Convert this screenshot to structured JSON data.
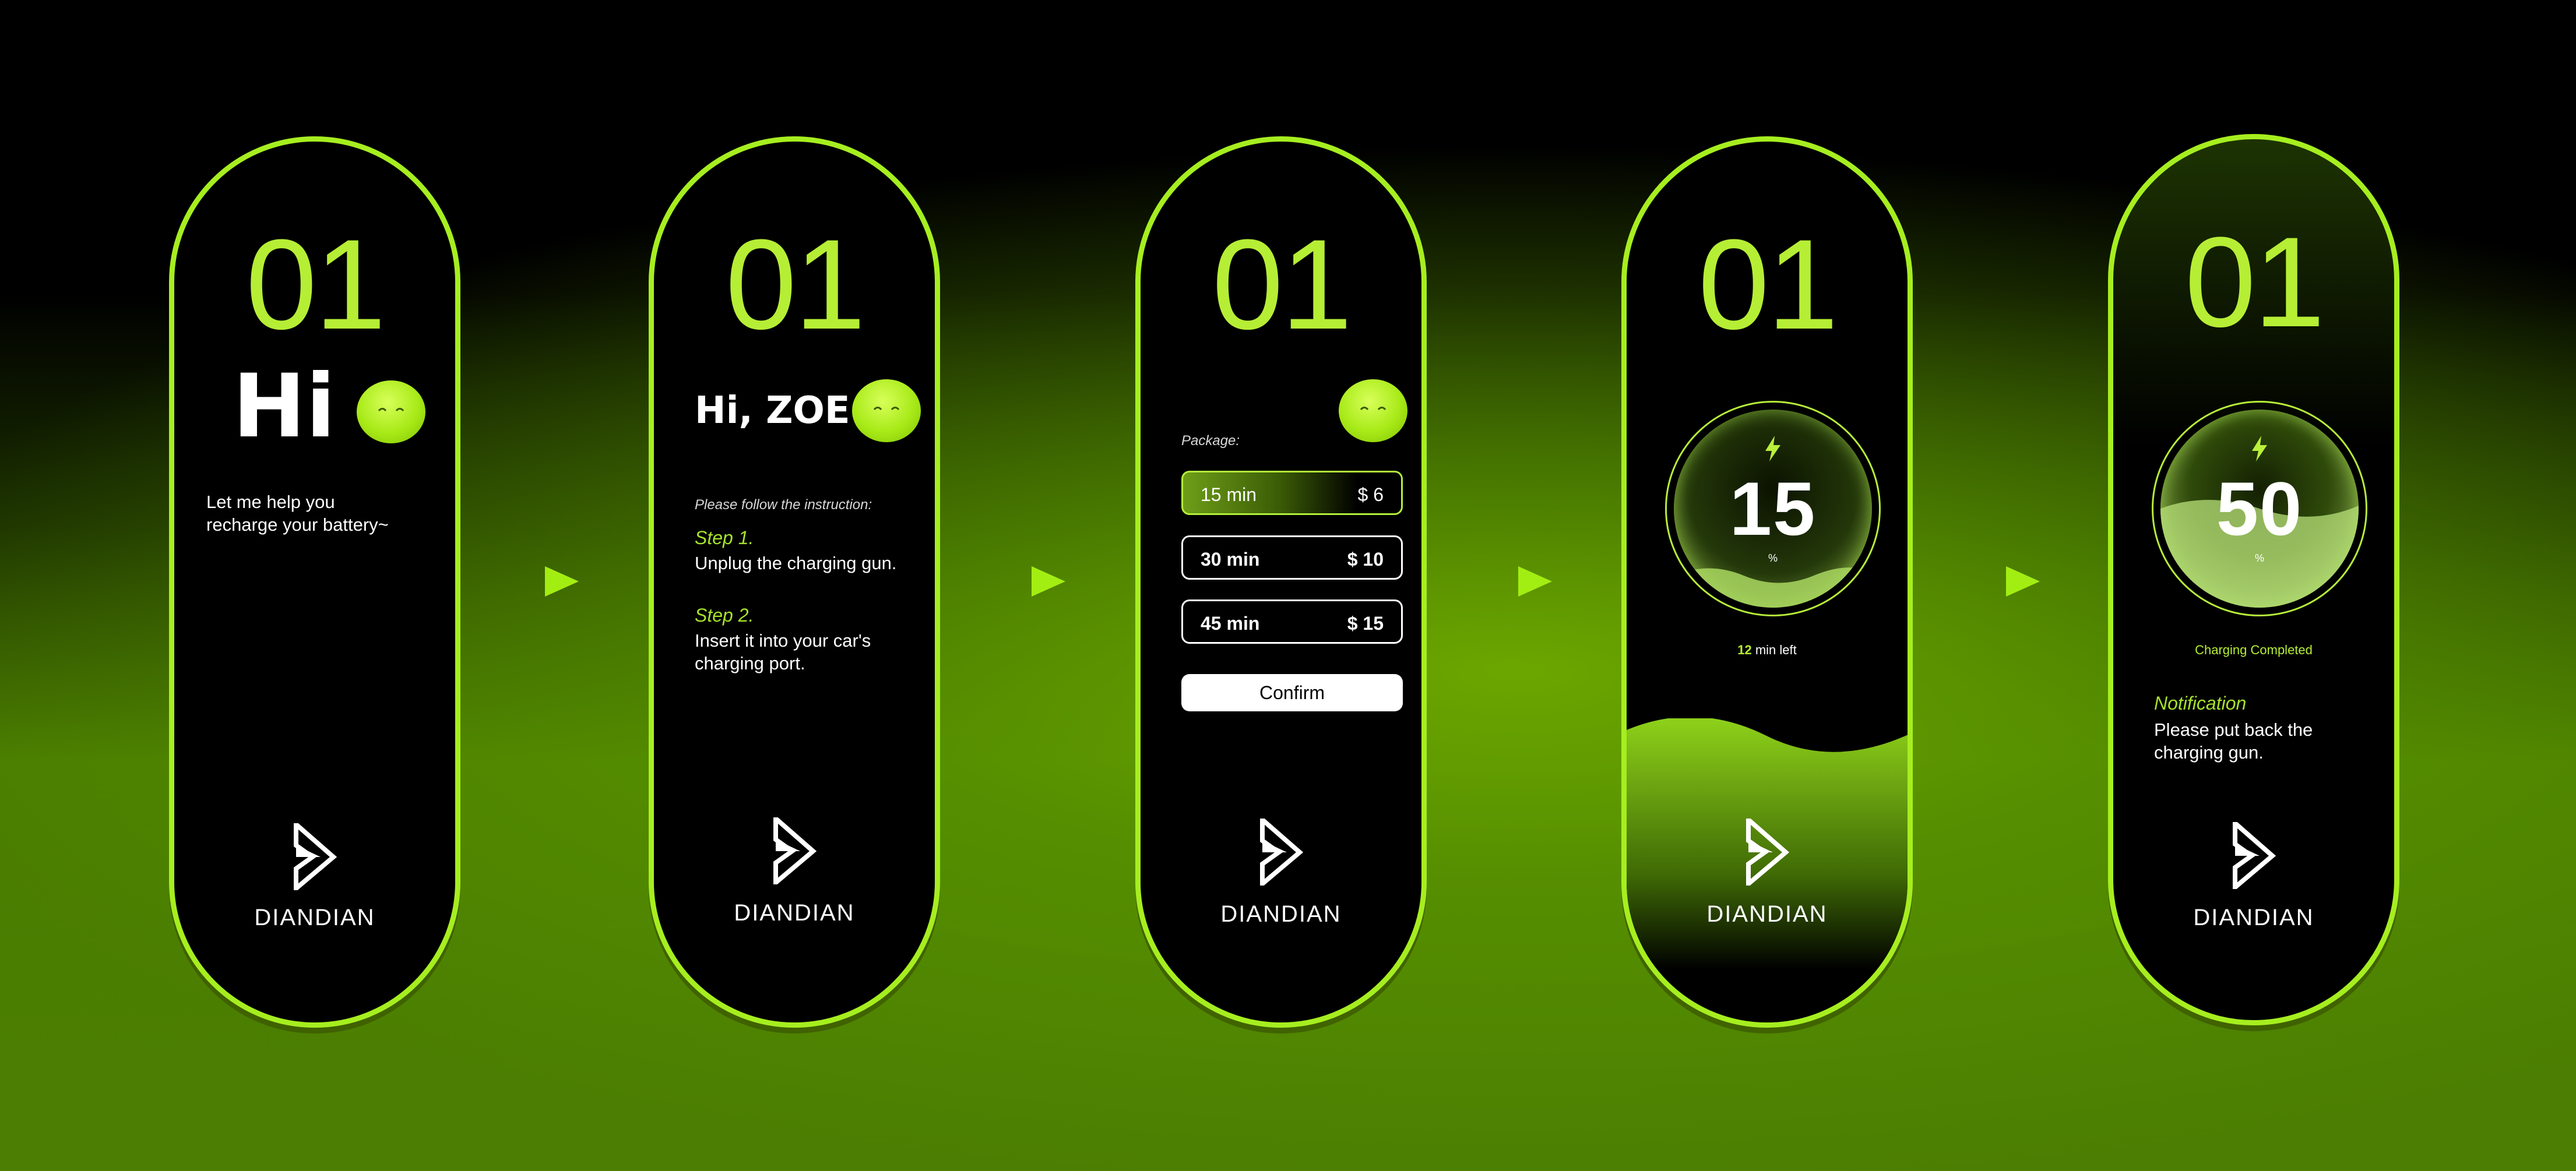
{
  "colors": {
    "accent": "#a6ee1f",
    "accent_text": "#b6ee35",
    "background_dark": "#000000",
    "background_green": "#4b7e02"
  },
  "cards": [
    {
      "step_number": "01",
      "greeting": "Hi",
      "message_line1": "Let me help you",
      "message_line2": "recharge your battery~",
      "brand": "DIANDIAN"
    },
    {
      "step_number": "01",
      "greeting": "Hi, ZOE",
      "instruction_intro": "Please follow the instruction:",
      "step1_label": "Step 1.",
      "step1_text": "Unplug the charging gun.",
      "step2_label": "Step 2.",
      "step2_line1": "Insert it into your car's",
      "step2_line2": "charging port.",
      "brand": "DIANDIAN"
    },
    {
      "step_number": "01",
      "package_label": "Package:",
      "packages": [
        {
          "time": "15 min",
          "price": "$ 6",
          "selected": true
        },
        {
          "time": "30 min",
          "price": "$ 10",
          "selected": false
        },
        {
          "time": "45 min",
          "price": "$ 15",
          "selected": false
        }
      ],
      "confirm_label": "Confirm",
      "brand": "DIANDIAN"
    },
    {
      "step_number": "01",
      "charge_percent": "15",
      "percent_sign": "%",
      "time_left_value": "12",
      "time_left_unit": "min left",
      "brand": "DIANDIAN"
    },
    {
      "step_number": "01",
      "charge_percent": "50",
      "percent_sign": "%",
      "status": "Charging Completed",
      "notification_label": "Notification",
      "notification_line1": "Please put back the",
      "notification_line2": "charging gun.",
      "brand": "DIANDIAN"
    }
  ],
  "icons": {
    "emoji": "smiling-face-icon",
    "logo": "diandian-logo-icon",
    "bolt": "lightning-bolt-icon",
    "arrow": "play-arrow-icon"
  }
}
